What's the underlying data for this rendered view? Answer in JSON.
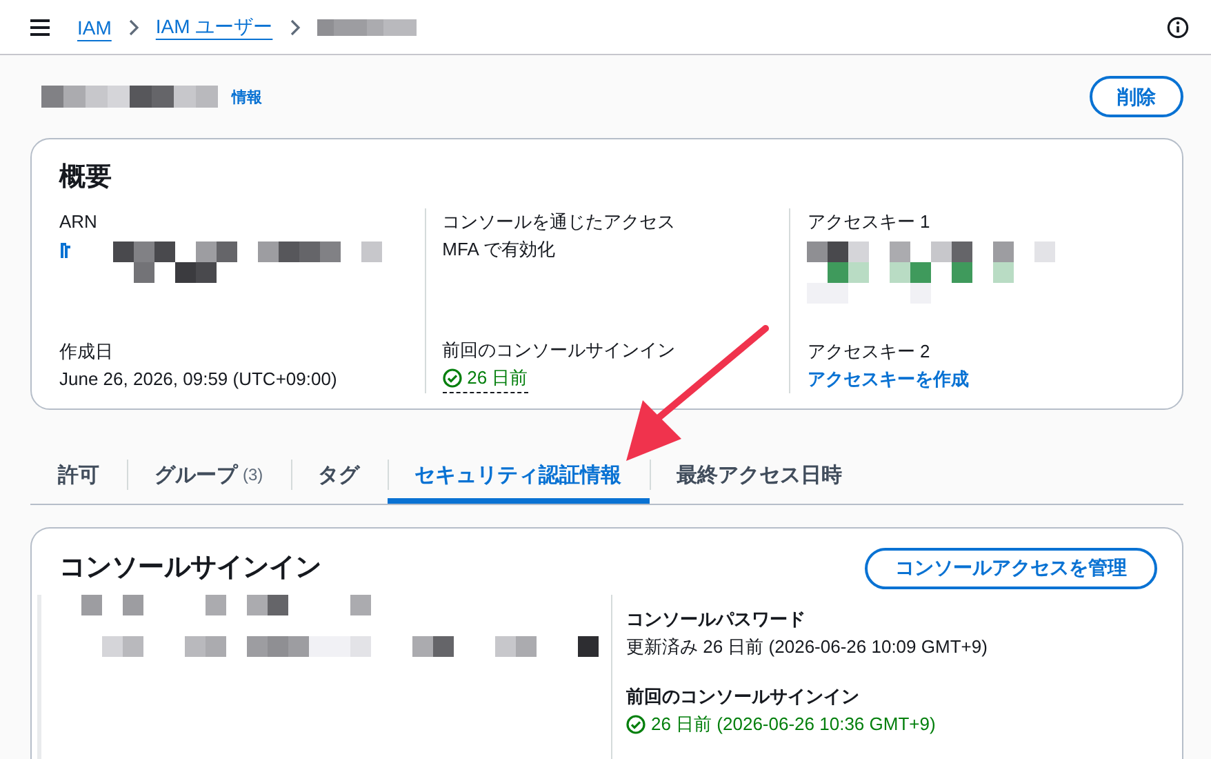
{
  "breadcrumbs": [
    {
      "kind": "link",
      "label": "IAM"
    },
    {
      "kind": "link",
      "label": "IAM ユーザー"
    },
    {
      "kind": "redacted"
    }
  ],
  "page_header": {
    "info_link": "情報",
    "delete_button": "削除"
  },
  "overview": {
    "title": "概要",
    "columns": [
      [
        {
          "label": "ARN",
          "kind": "redacted"
        },
        {
          "label": "作成日",
          "kind": "text",
          "value": "June 26, 2026, 09:59 (UTC+09:00)"
        }
      ],
      [
        {
          "label": "コンソールを通じたアクセス",
          "kind": "text",
          "value": "MFA で有効化"
        },
        {
          "label": "前回のコンソールサインイン",
          "kind": "status",
          "value": "26 日前"
        }
      ],
      [
        {
          "label": "アクセスキー 1",
          "kind": "redacted"
        },
        {
          "label": "アクセスキー 2",
          "kind": "link",
          "value": "アクセスキーを作成"
        }
      ]
    ]
  },
  "tabs": [
    {
      "label": "許可",
      "selected": false
    },
    {
      "label": "グループ",
      "count": "(3)",
      "selected": false
    },
    {
      "label": "タグ",
      "selected": false
    },
    {
      "label": "セキュリティ認証情報",
      "selected": true
    },
    {
      "label": "最終アクセス日時",
      "selected": false
    }
  ],
  "console_signin": {
    "title": "コンソールサインイン",
    "button": "コンソールアクセスを管理",
    "details": [
      {
        "label": "コンソールパスワード",
        "kind": "text",
        "value": "更新済み 26 日前 (2026-06-26 10:09 GMT+9)"
      },
      {
        "label": "前回のコンソールサインイン",
        "kind": "status",
        "value": "26 日前 (2026-06-26 10:36 GMT+9)"
      }
    ]
  }
}
